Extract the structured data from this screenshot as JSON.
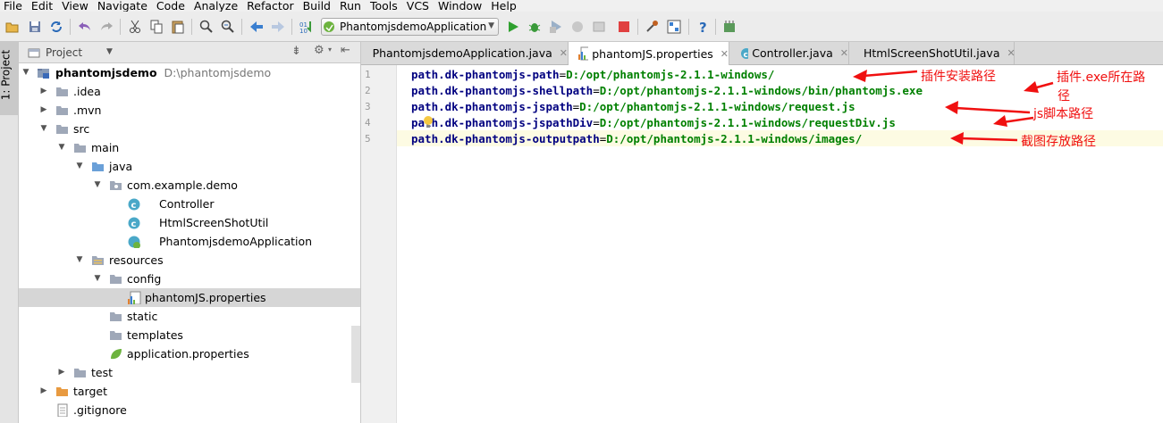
{
  "menu": [
    "File",
    "Edit",
    "View",
    "Navigate",
    "Code",
    "Analyze",
    "Refactor",
    "Build",
    "Run",
    "Tools",
    "VCS",
    "Window",
    "Help"
  ],
  "toolbar": {
    "run_config": "PhantomjsdemoApplication"
  },
  "left_tool": {
    "project_tab": "1: Project"
  },
  "project_panel": {
    "title": "Project"
  },
  "tree": [
    {
      "label": "phantomjsdemo",
      "path": "D:\\phantomjsdemo"
    },
    {
      "label": ".idea"
    },
    {
      "label": ".mvn"
    },
    {
      "label": "src"
    },
    {
      "label": "main"
    },
    {
      "label": "java"
    },
    {
      "label": "com.example.demo"
    },
    {
      "label": "Controller"
    },
    {
      "label": "HtmlScreenShotUtil"
    },
    {
      "label": "PhantomjsdemoApplication"
    },
    {
      "label": "resources"
    },
    {
      "label": "config"
    },
    {
      "label": "phantomJS.properties"
    },
    {
      "label": "static"
    },
    {
      "label": "templates"
    },
    {
      "label": "application.properties"
    },
    {
      "label": "test"
    },
    {
      "label": "target"
    },
    {
      "label": ".gitignore"
    }
  ],
  "tabs": [
    "PhantomjsdemoApplication.java",
    "phantomJS.properties",
    "Controller.java",
    "HtmlScreenShotUtil.java"
  ],
  "lines": [
    {
      "n": "1",
      "key": "path.dk-phantomjs-path",
      "eq": "=",
      "val": "D:/opt/phantomjs-2.1.1-windows/"
    },
    {
      "n": "2",
      "key": "path.dk-phantomjs-shellpath",
      "eq": "=",
      "val": "D:/opt/phantomjs-2.1.1-windows/bin/phantomjs.exe"
    },
    {
      "n": "3",
      "key": "path.dk-phantomjs-jspath",
      "eq": "=",
      "val": "D:/opt/phantomjs-2.1.1-windows/request.js"
    },
    {
      "n": "4",
      "key": "path.dk-phantomjs-jspathDiv",
      "eq": "=",
      "val": "D:/opt/phantomjs-2.1.1-windows/requestDiv.js"
    },
    {
      "n": "5",
      "key": "path.dk-phantomjs-outputpath",
      "eq": "=",
      "val": "D:/opt/phantomjs-2.1.1-windows/images/"
    }
  ],
  "annotations": [
    "插件安装路径",
    "插件.exe所在路",
    "径",
    "js脚本路径",
    "截图存放路径"
  ],
  "colors": {
    "annotation": "#f01010",
    "key": "#000080",
    "value": "#008000"
  }
}
